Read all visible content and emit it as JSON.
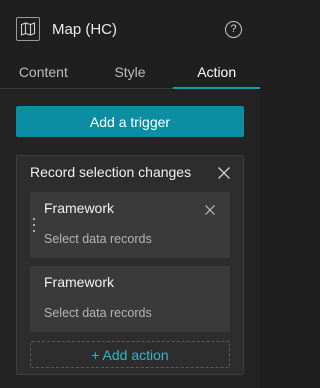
{
  "header": {
    "title": "Map (HC)",
    "help_icon": "help-icon",
    "widget_icon": "map-icon"
  },
  "tabs": [
    {
      "label": "Content",
      "active": false
    },
    {
      "label": "Style",
      "active": false
    },
    {
      "label": "Action",
      "active": true
    }
  ],
  "add_trigger_label": "Add a trigger",
  "trigger": {
    "title": "Record selection changes",
    "actions": [
      {
        "name": "Framework",
        "subtitle": "Select data records"
      },
      {
        "name": "Framework",
        "subtitle": "Select data records"
      }
    ],
    "add_action_label": "+ Add action"
  },
  "colors": {
    "accent": "#0c8ea2",
    "link": "#35b6c8",
    "background": "#1f1f1f"
  }
}
